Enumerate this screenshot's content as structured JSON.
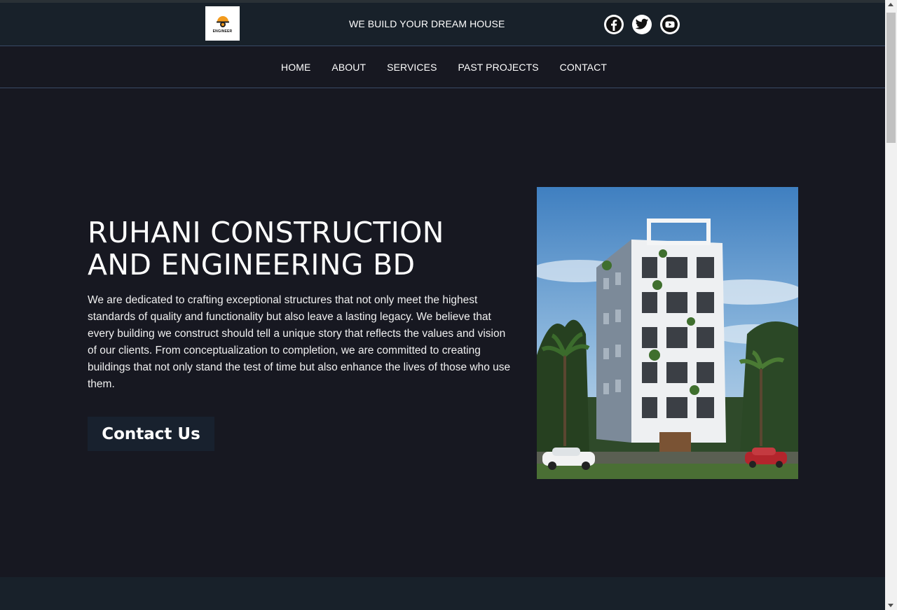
{
  "header": {
    "logo_text": "ENGINEER",
    "tagline": "WE BUILD YOUR DREAM HOUSE",
    "socials": [
      {
        "icon": "facebook-icon"
      },
      {
        "icon": "twitter-icon"
      },
      {
        "icon": "youtube-icon"
      }
    ]
  },
  "nav": {
    "items": [
      "HOME",
      "ABOUT",
      "SERVICES",
      "PAST PROJECTS",
      "CONTACT"
    ]
  },
  "hero": {
    "title_line1": "RUHANI CONSTRUCTION",
    "title_line2": "AND ENGINEERING BD",
    "text": "We are dedicated to crafting exceptional structures that not only meet the highest standards of quality and functionality but also leave a lasting legacy. We believe that every building we construct should tell a unique story that reflects the values and vision of our clients. From conceptualization to completion, we are committed to creating buildings that not only stand the test of time but also enhance the lives of those who use them.",
    "cta_label": "Contact Us"
  },
  "colors": {
    "background": "#171821",
    "header": "#18212a",
    "divider": "#3a4a66",
    "button": "#18212e"
  }
}
